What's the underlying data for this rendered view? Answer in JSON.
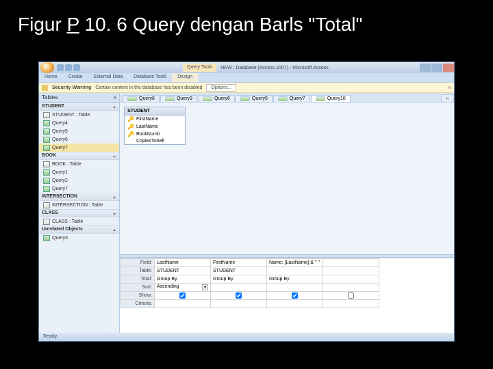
{
  "slide_title_parts": {
    "pre": "Figur",
    "u": "P",
    "rest": " 10. 6 Query dengan Barls \"Total\""
  },
  "titlebar": {
    "context_tab": "Query Tools",
    "app_title": "NEW : Database (Access 2007) - Microsoft Access"
  },
  "ribbon_tabs": [
    "Home",
    "Create",
    "External Data",
    "Database Tools",
    "Design"
  ],
  "security": {
    "label": "Security Warning",
    "msg": "Certain content in the database has been disabled",
    "btn": "Options..."
  },
  "nav": {
    "header": "Tables",
    "groups": [
      {
        "name": "STUDENT",
        "items": [
          {
            "ic": "tbl",
            "label": "STUDENT : Table"
          },
          {
            "ic": "qry",
            "label": "Query4"
          },
          {
            "ic": "qry",
            "label": "Query5"
          },
          {
            "ic": "qry",
            "label": "Query6"
          },
          {
            "ic": "qry",
            "label": "Query7",
            "sel": true
          }
        ]
      },
      {
        "name": "BOOK",
        "items": [
          {
            "ic": "tbl",
            "label": "BOOK : Table"
          },
          {
            "ic": "qry",
            "label": "Query1"
          },
          {
            "ic": "qry",
            "label": "Query2"
          },
          {
            "ic": "qry",
            "label": "Query7"
          }
        ]
      },
      {
        "name": "INTERSECTION",
        "items": [
          {
            "ic": "tbl",
            "label": "INTERSECTION : Table"
          }
        ]
      },
      {
        "name": "CLASS",
        "items": [
          {
            "ic": "tbl",
            "label": "CLASS : Table"
          }
        ]
      },
      {
        "name": "Unrelated Objects",
        "items": [
          {
            "ic": "qry",
            "label": "Query3"
          }
        ]
      }
    ]
  },
  "doctabs": [
    "Query8",
    "Query9",
    "Query6",
    "Query5",
    "Query7",
    "Query10"
  ],
  "doctab_active_index": 5,
  "tablebox": {
    "title": "STUDENT",
    "fields": [
      {
        "key": true,
        "name": "FirstName"
      },
      {
        "key": true,
        "name": "LastName"
      },
      {
        "key": true,
        "name": "BookNumb"
      },
      {
        "key": false,
        "name": "CopiesToSell"
      }
    ]
  },
  "grid": {
    "row_labels": [
      "Field:",
      "Table:",
      "Total:",
      "Sort:",
      "Show:",
      "Criteria:"
    ],
    "cols": [
      {
        "field": "LastName",
        "table": "STUDENT",
        "total": "Group By",
        "sort": "Ascending",
        "sort_dd": true,
        "show": true
      },
      {
        "field": "FirstName",
        "table": "STUDENT",
        "total": "Group By",
        "sort": "",
        "show": true
      },
      {
        "field": "Name: [LastName] & \" \"",
        "table": "",
        "total": "Group By",
        "sort": "",
        "show": true
      },
      {
        "field": "",
        "table": "",
        "total": "",
        "sort": "",
        "show": false
      }
    ]
  },
  "status": "Ready"
}
